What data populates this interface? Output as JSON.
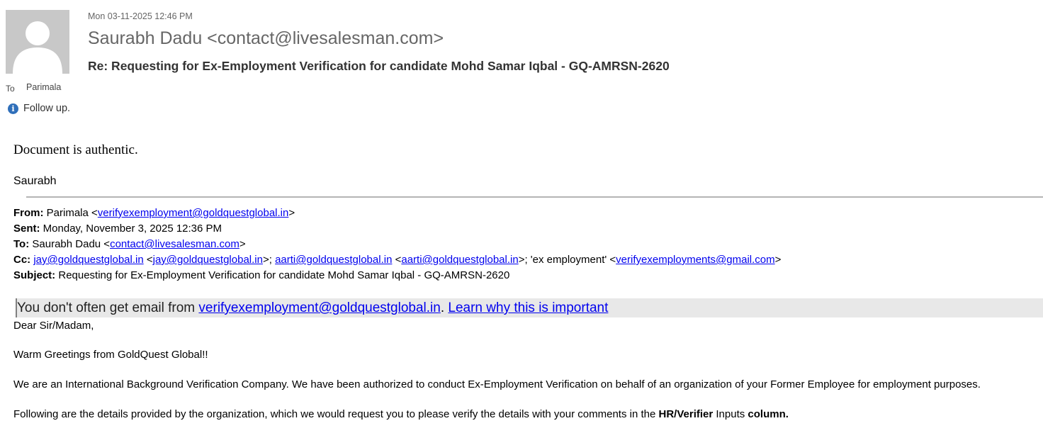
{
  "header": {
    "date": "Mon 03-11-2025 12:46 PM",
    "sender": "Saurabh Dadu <contact@livesalesman.com>",
    "subject": "Re: Requesting for Ex-Employment Verification for candidate Mohd Samar Iqbal - GQ-AMRSN-2620",
    "to_label": "To",
    "to_name": "Parimala",
    "followup": "Follow up."
  },
  "reply": {
    "body": "Document is authentic.",
    "signature": "Saurabh"
  },
  "forwarded": {
    "from_label": "From:",
    "from_name": "Parimala <",
    "from_email": "verifyexemployment@goldquestglobal.in",
    "from_close": ">",
    "sent_label": "Sent:",
    "sent_value": "Monday, November 3, 2025 12:36 PM",
    "to_label": "To:",
    "to_name": "Saurabh Dadu <",
    "to_email": "contact@livesalesman.com",
    "to_close": ">",
    "cc_label": "Cc:",
    "cc_1": "jay@goldquestglobal.in",
    "cc_sep1": " <",
    "cc_1b": "jay@goldquestglobal.in",
    "cc_sep2": ">; ",
    "cc_2": "aarti@goldquestglobal.in",
    "cc_sep3": " <",
    "cc_2b": "aarti@goldquestglobal.in",
    "cc_sep4": ">; 'ex employment' <",
    "cc_3": "verifyexemployments@gmail.com",
    "cc_close": ">",
    "subject_label": "Subject:",
    "subject_value": "Requesting for Ex-Employment Verification for candidate Mohd Samar Iqbal - GQ-AMRSN-2620"
  },
  "banner": {
    "text": "You don't often get email from ",
    "email": "verifyexemployment@goldquestglobal.in",
    "dot": ". ",
    "learn": "Learn why this is important"
  },
  "body": {
    "greeting": "Dear Sir/Madam,",
    "warm": "Warm Greetings from GoldQuest Global!!",
    "intro": "We are an International Background Verification Company. We have been authorized to conduct Ex-Employment Verification on behalf of an organization of your Former Employee for employment purposes.",
    "following_pre": "Following are the details provided by the organization, which we would request you to please verify the details with your comments in the ",
    "following_bold1": "HR/Verifier",
    "following_mid": " Inputs ",
    "following_bold2": "column."
  },
  "colors": {
    "link": "#0000ee",
    "banner_bg": "#e8e8e8",
    "info_icon": "#2f6fba"
  }
}
